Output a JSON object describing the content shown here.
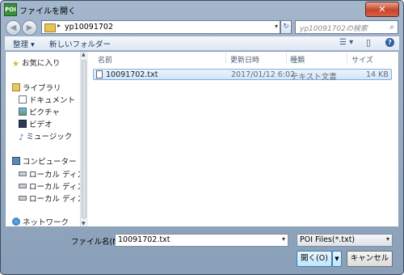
{
  "window": {
    "title": "ファイルを開く",
    "app_icon_text": "POI",
    "close_glyph": "✕"
  },
  "nav": {
    "back_glyph": "◀",
    "forward_glyph": "▶"
  },
  "address": {
    "arrow": "▸",
    "path": "yp10091702",
    "dropdown": "▾"
  },
  "refresh": {
    "glyph": "↻"
  },
  "search": {
    "placeholder": "yp10091702の検索",
    "icon": "search-icon"
  },
  "toolbar": {
    "organize": "整理 ▾",
    "new_folder": "新しいフォルダー",
    "view_glyph": "☰ ▾",
    "pane_glyph": "▯",
    "help_glyph": "?"
  },
  "sidebar": {
    "favorites": "お気に入り",
    "library": "ライブラリ",
    "library_items": [
      "ドキュメント",
      "ピクチャ",
      "ビデオ",
      "ミュージック"
    ],
    "computer": "コンピューター",
    "drives": [
      "ローカル ディス",
      "ローカル ディス",
      "ローカル ディス"
    ],
    "network": "ネットワーク"
  },
  "file_list": {
    "columns": [
      "名前",
      "更新日時",
      "種類",
      "サイズ"
    ],
    "rows": [
      {
        "name": "10091702.txt",
        "modified": "2017/01/12 6:02",
        "type": "テキスト文書",
        "size": "14 KB"
      }
    ]
  },
  "footer": {
    "filename_label": "ファイル名(N):",
    "filename_value": "10091702.txt",
    "filetype_value": "POI Files(*.txt)",
    "open_label": "開く(O)",
    "cancel_label": "キャンセル"
  },
  "colors": {
    "selection": "#cfe6fb",
    "title_close": "#c8442a"
  }
}
